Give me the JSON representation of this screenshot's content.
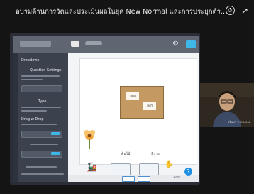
{
  "video": {
    "title": "อบรมด้านการวัดและประเมินผลในยุค New Normal และการประยุกต์ระบบเทคโนโลยีสารสน...",
    "icons": [
      "clock-icon",
      "share-icon"
    ]
  },
  "app": {
    "panel": {
      "heading": "Dropdown",
      "sections": [
        "Question Settings",
        "Type",
        "Drag ⇄ Drop"
      ]
    },
    "canvas": {
      "board_notes": [
        "ทอง",
        "ลิงกิ"
      ],
      "scene_labels": [
        "ต้นไม้",
        "ที่ราย"
      ]
    },
    "bottom": {
      "help_label": "?",
      "zoom": "100%"
    }
  },
  "webcam": {
    "name": "อรินทร์ ขาวสะอาด"
  },
  "colors": {
    "accent": "#3fb7e8",
    "help": "#1f8fe6",
    "panel": "#3b414d",
    "board": "#c59a62"
  }
}
